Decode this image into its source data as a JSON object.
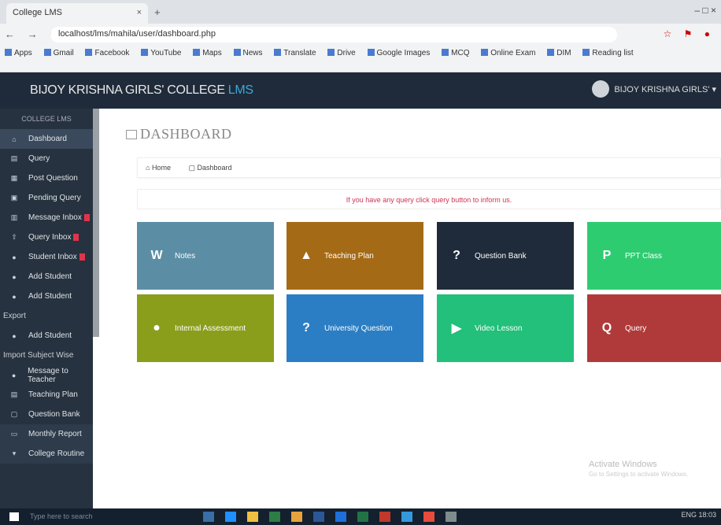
{
  "browser": {
    "tab_title": "College LMS",
    "close_glyph": "×",
    "new_tab_glyph": "+",
    "window_controls": "– □ ×",
    "nav_glyphs": "← → C",
    "url": "localhost/lms/mahila/user/dashboard.php",
    "addr_icons": "☆ ⚑ ●",
    "bookmarks": [
      "Apps",
      "Gmail",
      "Facebook",
      "YouTube",
      "Maps",
      "News",
      "Translate",
      "Drive",
      "Google Images",
      "MCQ",
      "Online Exam",
      "DIM",
      "Reading list"
    ]
  },
  "topnav": {
    "brand": "BIJOY KRISHNA GIRLS' COLLEGE",
    "brand_suffix": "LMS",
    "user_name": "BIJOY KRISHNA GIRLS' ▾"
  },
  "sidebar": {
    "title": "COLLEGE LMS",
    "items": [
      {
        "label": "Dashboard",
        "icon": "home-icon"
      },
      {
        "label": "Query",
        "icon": "query-icon"
      },
      {
        "label": "Post Question",
        "icon": "list-icon"
      },
      {
        "label": "Pending Query",
        "icon": "pending-icon"
      },
      {
        "label": "Message Inbox",
        "icon": "inbox-icon"
      },
      {
        "label": "Query Inbox",
        "icon": "query-inbox-icon"
      },
      {
        "label": "Student Inbox",
        "icon": "student-inbox-icon"
      },
      {
        "label": "Add Student",
        "icon": "user-add-icon"
      },
      {
        "label": "Add Student",
        "icon": "user-add-icon"
      }
    ],
    "section1": "Export",
    "item_after_s1": {
      "label": "Add Student",
      "icon": "user-icon"
    },
    "section2": "Import Subject Wise",
    "items2": [
      {
        "label": "Message to Teacher",
        "icon": "message-icon"
      },
      {
        "label": "Teaching Plan",
        "icon": "plan-icon"
      },
      {
        "label": "Question Bank",
        "icon": "bank-icon"
      },
      {
        "label": "Monthly Report",
        "icon": "report-icon"
      },
      {
        "label": "College Routine",
        "icon": "routine-icon"
      }
    ]
  },
  "content": {
    "page_title": "DASHBOARD",
    "breadcrumb": [
      "Home",
      "Dashboard"
    ],
    "info_text": "If you have any query click query button to inform us.",
    "tiles": [
      {
        "label": "Notes",
        "icon": "W"
      },
      {
        "label": "Teaching Plan",
        "icon": "▲"
      },
      {
        "label": "Question Bank",
        "icon": "?"
      },
      {
        "label": "PPT Class",
        "icon": "P"
      },
      {
        "label": "Internal Assessment",
        "icon": "●"
      },
      {
        "label": "University Question",
        "icon": "?"
      },
      {
        "label": "Video Lesson",
        "icon": "▶"
      },
      {
        "label": "Query",
        "icon": "Q"
      }
    ]
  },
  "watermark": {
    "title": "Activate Windows",
    "sub": "Go to Settings to activate Windows."
  },
  "taskbar": {
    "search": "Type here to search",
    "clock": "ENG 18:03"
  }
}
